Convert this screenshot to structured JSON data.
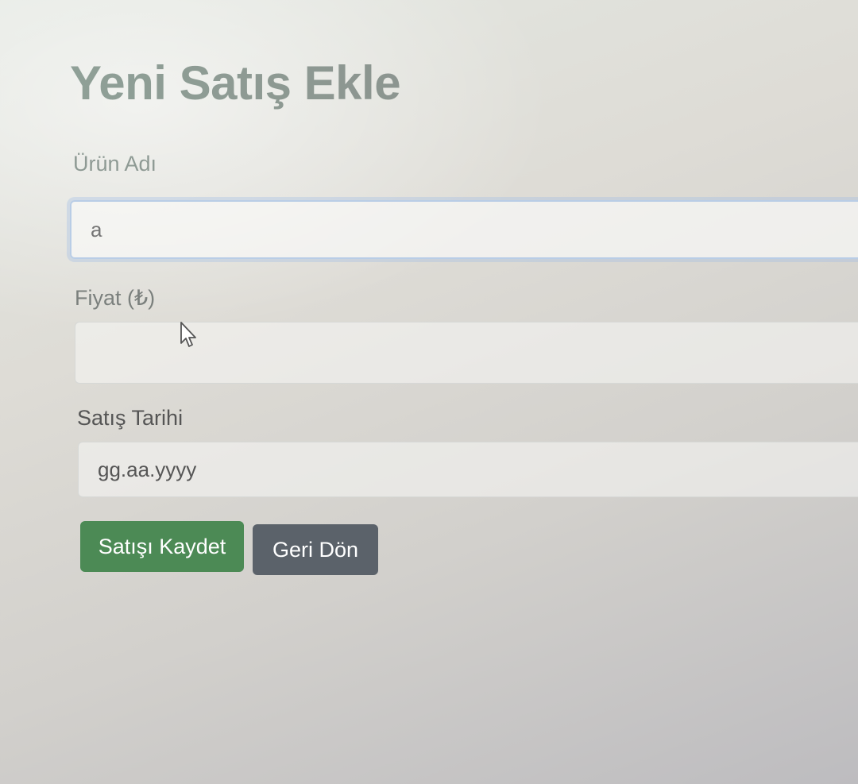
{
  "page": {
    "title": "Yeni Satış Ekle"
  },
  "form": {
    "product_name": {
      "label": "Ürün Adı",
      "value": "",
      "placeholder": "a"
    },
    "price": {
      "label": "Fiyat (₺)",
      "value": "",
      "placeholder": ""
    },
    "sale_date": {
      "label": "Satış Tarihi",
      "value": "",
      "placeholder": "gg.aa.yyyy"
    }
  },
  "buttons": {
    "save_label": "Satışı Kaydet",
    "back_label": "Geri Dön"
  },
  "colors": {
    "save_button": "#4c8a55",
    "back_button": "#5b626a",
    "focus_ring": "#b9cde6"
  },
  "icons": {
    "cursor": "mouse-pointer-icon"
  }
}
